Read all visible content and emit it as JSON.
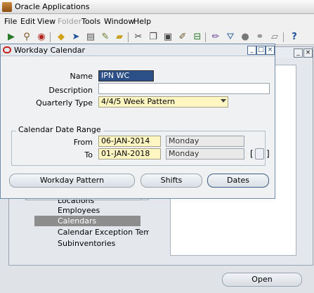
{
  "window": {
    "title": "Oracle Applications"
  },
  "menubar": [
    {
      "label": "File",
      "enabled": true
    },
    {
      "label": "Edit",
      "enabled": true
    },
    {
      "label": "View",
      "enabled": true
    },
    {
      "label": "Folder",
      "enabled": false
    },
    {
      "label": "Tools",
      "enabled": true
    },
    {
      "label": "Window",
      "enabled": true
    },
    {
      "label": "Help",
      "enabled": true
    }
  ],
  "toolbar": {
    "icons": [
      "new-record-icon",
      "find-icon",
      "navigator-icon",
      "save-icon",
      "next-step-icon",
      "print-icon",
      "close-form-icon",
      "cut-icon",
      "copy-icon",
      "paste-icon",
      "clear-record-icon",
      "delete-record-icon",
      "edit-field-icon",
      "zoom-icon",
      "translations-icon",
      "attachments-icon",
      "folder-tools-icon",
      "help-icon"
    ]
  },
  "dialog": {
    "title": "Workday Calendar",
    "name_label": "Name",
    "name_value": "IPN WC",
    "description_label": "Description",
    "description_value": "",
    "quarterly_type_label": "Quarterly Type",
    "quarterly_type_value": "4/4/5 Week Pattern",
    "range_title": "Calendar Date Range",
    "from_label": "From",
    "from_date": "06-JAN-2014",
    "from_day": "Monday",
    "to_label": "To",
    "to_date": "01-JAN-2018",
    "to_day": "Monday",
    "buttons": {
      "workday_pattern": "Workday Pattern",
      "shifts": "Shifts",
      "dates": "Dates"
    }
  },
  "navigator": {
    "items": [
      "Locations",
      "Employees",
      "Calendars",
      "Calendar Exception Templates",
      "Subinventories"
    ],
    "selected": "Calendars",
    "open_label": "Open"
  },
  "colors": {
    "required_field": "#fff6c2",
    "selected_item": "#8d8d8d",
    "name_highlight": "#2b4f86"
  }
}
